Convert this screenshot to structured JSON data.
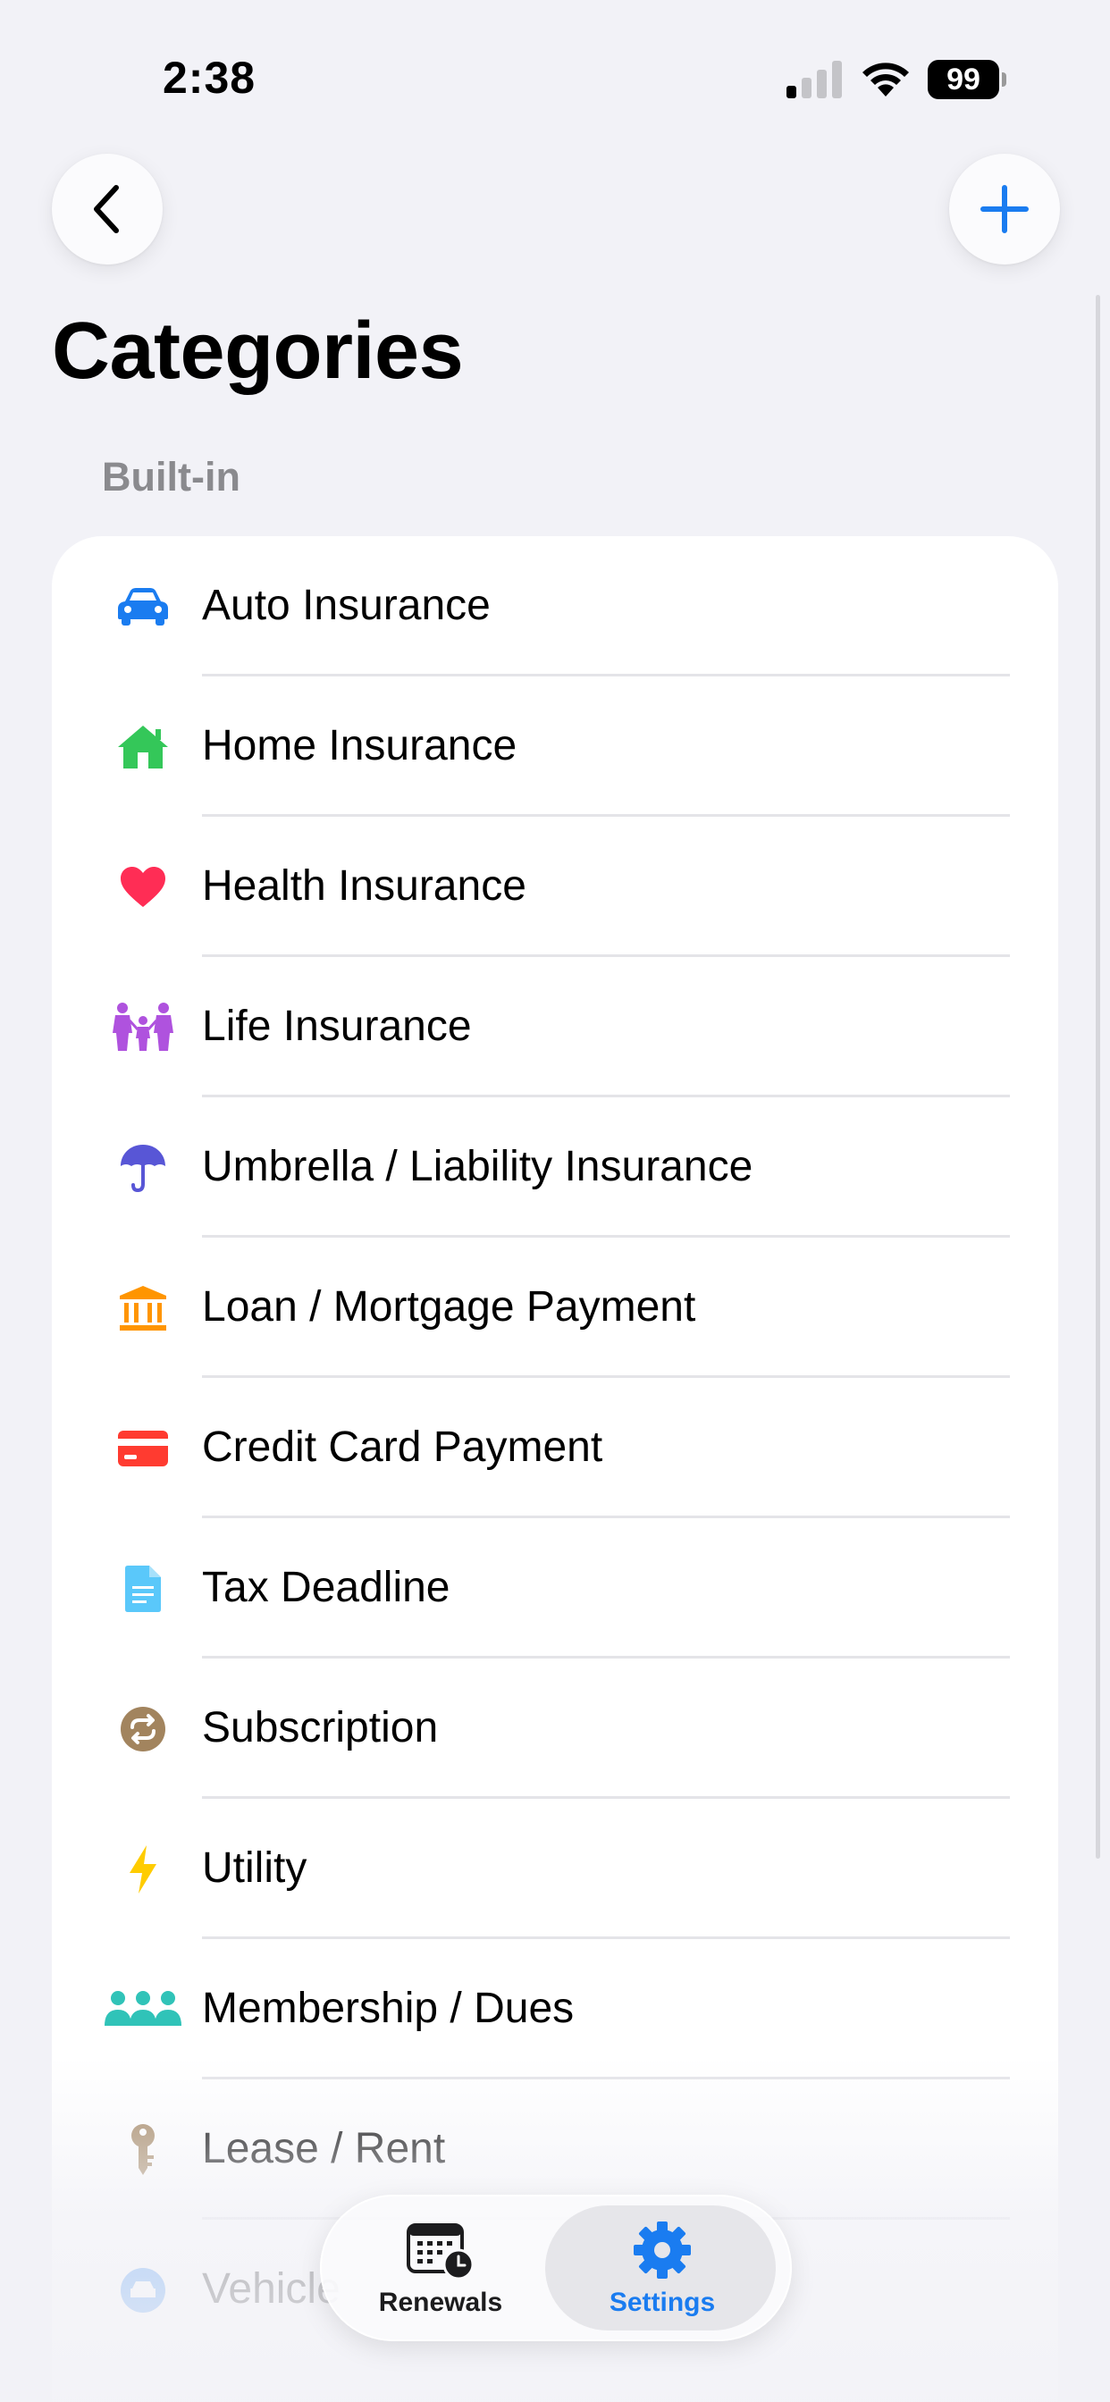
{
  "status_bar": {
    "time": "2:38",
    "battery": "99"
  },
  "nav": {
    "back_icon": "chevron-left-icon",
    "add_icon": "plus-icon"
  },
  "page": {
    "title": "Categories",
    "section": "Built-in"
  },
  "colors": {
    "accent": "#1a7cf0",
    "background": "#f2f2f7"
  },
  "categories": [
    {
      "label": "Auto Insurance",
      "icon": "car-icon",
      "color": "#1a7cf0"
    },
    {
      "label": "Home Insurance",
      "icon": "house-icon",
      "color": "#34c759"
    },
    {
      "label": "Health Insurance",
      "icon": "heart-icon",
      "color": "#ff2d55"
    },
    {
      "label": "Life Insurance",
      "icon": "family-icon",
      "color": "#af52de"
    },
    {
      "label": "Umbrella / Liability Insurance",
      "icon": "umbrella-icon",
      "color": "#5856d6"
    },
    {
      "label": "Loan / Mortgage Payment",
      "icon": "bank-icon",
      "color": "#ff9500"
    },
    {
      "label": "Credit Card Payment",
      "icon": "credit-card-icon",
      "color": "#ff3b30"
    },
    {
      "label": "Tax Deadline",
      "icon": "document-icon",
      "color": "#5ac8fa"
    },
    {
      "label": "Subscription",
      "icon": "repeat-icon",
      "color": "#a2845e"
    },
    {
      "label": "Utility",
      "icon": "bolt-icon",
      "color": "#ffcc00"
    },
    {
      "label": "Membership / Dues",
      "icon": "people-icon",
      "color": "#30c3b8"
    },
    {
      "label": "Lease / Rent",
      "icon": "key-icon",
      "color": "#a2845e"
    },
    {
      "label": "Vehicle",
      "icon": "car-circle-icon",
      "color": "#1a7cf0"
    }
  ],
  "tabs": [
    {
      "label": "Renewals",
      "icon": "calendar-clock-icon",
      "active": false
    },
    {
      "label": "Settings",
      "icon": "gear-icon",
      "active": true
    }
  ]
}
